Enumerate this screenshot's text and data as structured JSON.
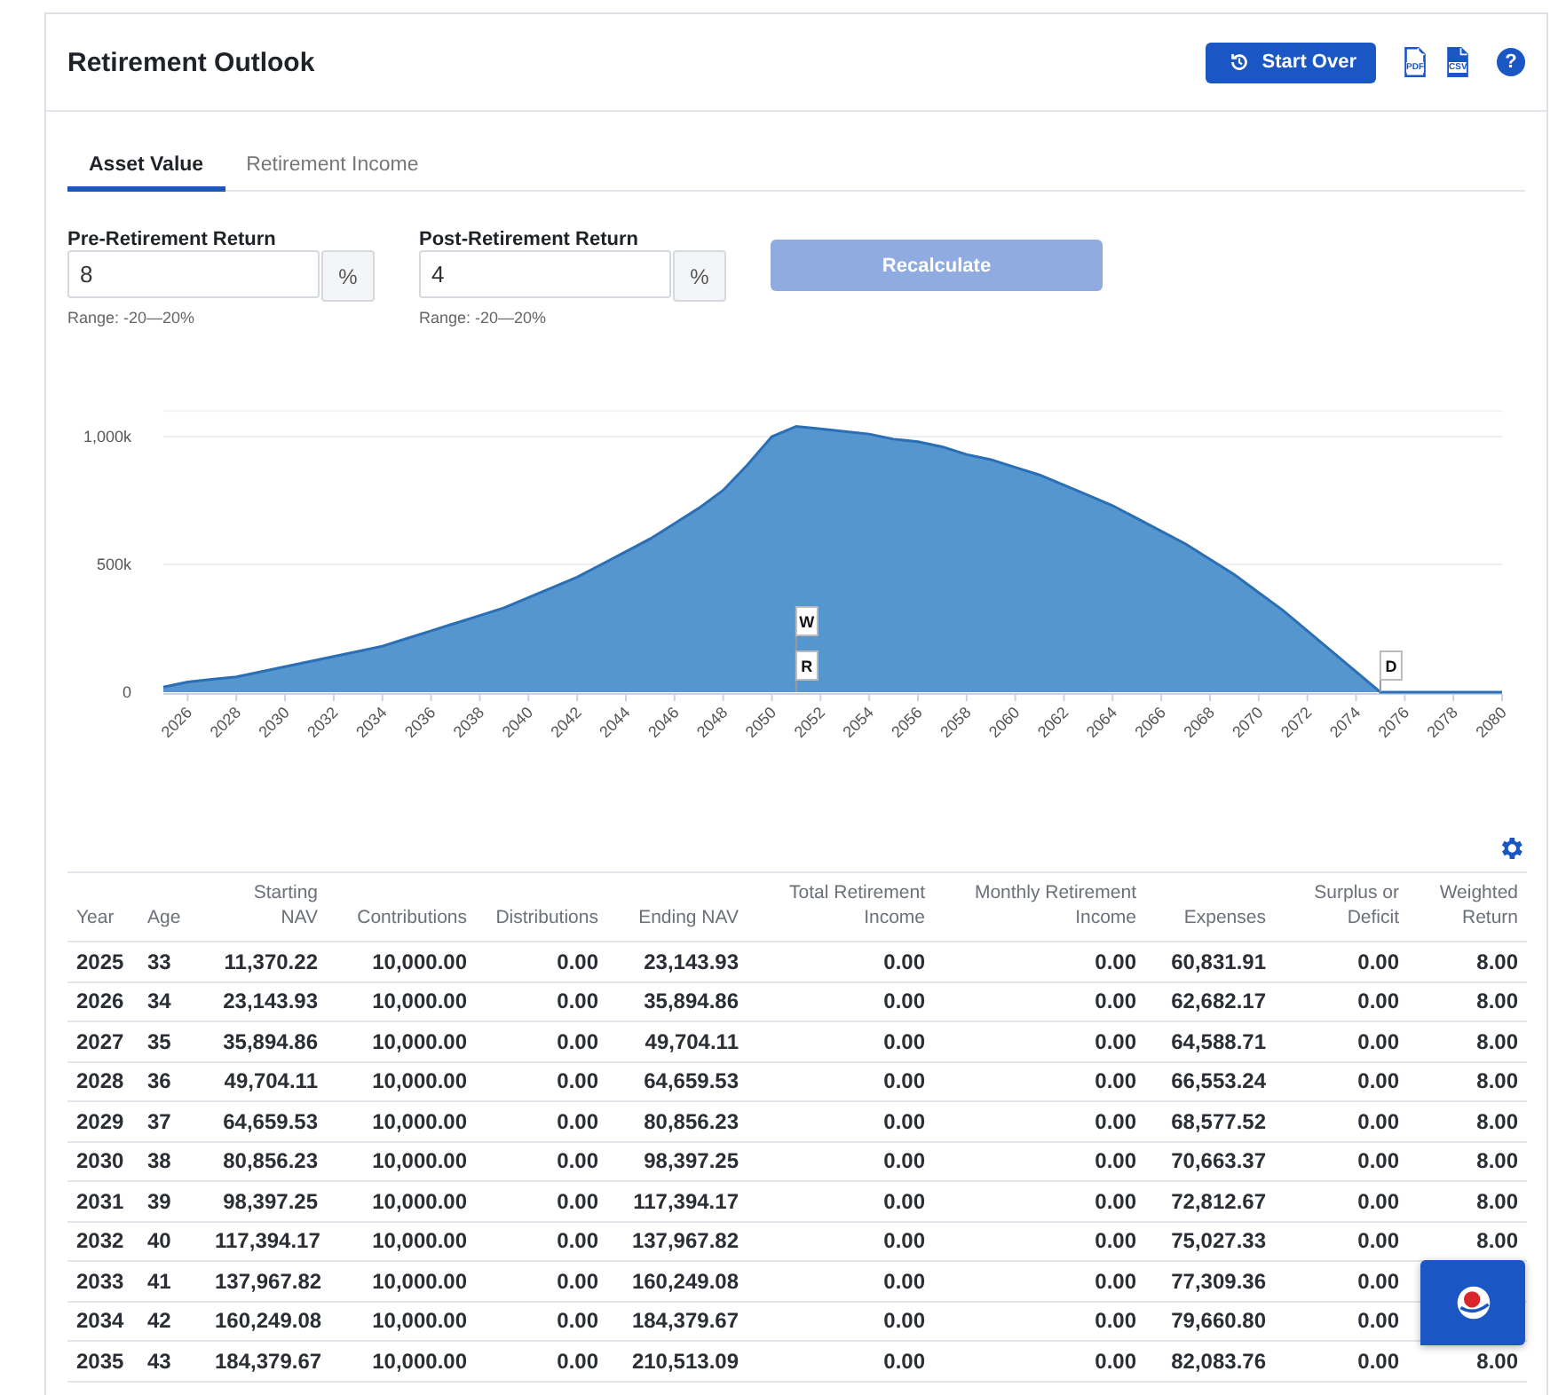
{
  "header": {
    "title": "Retirement Outlook",
    "start_over": "Start Over",
    "export_icons": [
      {
        "kind": "pdf",
        "label": "PDF"
      },
      {
        "kind": "csv",
        "label": "CSV"
      }
    ],
    "help": "?"
  },
  "tabs": [
    {
      "label": "Asset Value",
      "selected": true
    },
    {
      "label": "Retirement Income",
      "selected": false
    }
  ],
  "inputs": [
    {
      "label": "Pre-Retirement Return",
      "value": "8",
      "unit": "%",
      "hint": "Range: -20—20%"
    },
    {
      "label": "Post-Retirement Return",
      "value": "4",
      "unit": "%",
      "hint": "Range: -20—20%"
    }
  ],
  "recalculate": {
    "label": "Recalculate",
    "disabled": true
  },
  "chart": {
    "chart_data": {
      "type": "area",
      "x": [
        2025,
        2026,
        2027,
        2028,
        2029,
        2030,
        2031,
        2032,
        2033,
        2034,
        2035,
        2036,
        2037,
        2038,
        2039,
        2040,
        2041,
        2042,
        2043,
        2044,
        2045,
        2046,
        2047,
        2048,
        2049,
        2050,
        2051,
        2052,
        2053,
        2054,
        2055,
        2056,
        2057,
        2058,
        2059,
        2060,
        2061,
        2062,
        2063,
        2064,
        2065,
        2066,
        2067,
        2068,
        2069,
        2070,
        2071,
        2072,
        2073,
        2074,
        2075,
        2076,
        2077,
        2078,
        2079,
        2080
      ],
      "series": [
        {
          "color": "#5596cf",
          "values": [
            20000,
            40000,
            50000,
            60000,
            80000,
            100000,
            120000,
            140000,
            160000,
            180000,
            210000,
            240000,
            270000,
            300000,
            330000,
            370000,
            410000,
            450000,
            500000,
            550000,
            600000,
            660000,
            720000,
            790000,
            890000,
            1000000,
            1040000,
            1030000,
            1020000,
            1010000,
            990000,
            980000,
            960000,
            930000,
            910000,
            880000,
            850000,
            810000,
            770000,
            730000,
            680000,
            630000,
            580000,
            520000,
            460000,
            390000,
            320000,
            240000,
            160000,
            80000,
            0,
            0,
            0,
            0,
            0,
            0
          ]
        }
      ],
      "xlim": [
        2025,
        2080
      ],
      "xticks": [
        2026,
        2028,
        2030,
        2032,
        2034,
        2036,
        2038,
        2040,
        2042,
        2044,
        2046,
        2048,
        2050,
        2052,
        2054,
        2056,
        2058,
        2060,
        2062,
        2064,
        2066,
        2068,
        2070,
        2072,
        2074,
        2076,
        2078,
        2080
      ],
      "yticks": [
        {
          "value": 0,
          "label": "0"
        },
        {
          "value": 500000,
          "label": "500k"
        },
        {
          "value": 1000000,
          "label": "1,000k"
        }
      ],
      "ylim": [
        0,
        1100000
      ],
      "annotations": [
        "W",
        "R",
        "D"
      ]
    }
  },
  "table": {
    "columns": [
      "Year",
      "Age",
      "Starting NAV",
      "Contributions",
      "Distributions",
      "Ending NAV",
      "Total Retirement Income",
      "Monthly Retirement Income",
      "Expenses",
      "Surplus or Deficit",
      "Weighted Return"
    ],
    "rows": [
      [
        "2025",
        "33",
        "11,370.22",
        "10,000.00",
        "0.00",
        "23,143.93",
        "0.00",
        "0.00",
        "60,831.91",
        "0.00",
        "8.00"
      ],
      [
        "2026",
        "34",
        "23,143.93",
        "10,000.00",
        "0.00",
        "35,894.86",
        "0.00",
        "0.00",
        "62,682.17",
        "0.00",
        "8.00"
      ],
      [
        "2027",
        "35",
        "35,894.86",
        "10,000.00",
        "0.00",
        "49,704.11",
        "0.00",
        "0.00",
        "64,588.71",
        "0.00",
        "8.00"
      ],
      [
        "2028",
        "36",
        "49,704.11",
        "10,000.00",
        "0.00",
        "64,659.53",
        "0.00",
        "0.00",
        "66,553.24",
        "0.00",
        "8.00"
      ],
      [
        "2029",
        "37",
        "64,659.53",
        "10,000.00",
        "0.00",
        "80,856.23",
        "0.00",
        "0.00",
        "68,577.52",
        "0.00",
        "8.00"
      ],
      [
        "2030",
        "38",
        "80,856.23",
        "10,000.00",
        "0.00",
        "98,397.25",
        "0.00",
        "0.00",
        "70,663.37",
        "0.00",
        "8.00"
      ],
      [
        "2031",
        "39",
        "98,397.25",
        "10,000.00",
        "0.00",
        "117,394.17",
        "0.00",
        "0.00",
        "72,812.67",
        "0.00",
        "8.00"
      ],
      [
        "2032",
        "40",
        "117,394.17",
        "10,000.00",
        "0.00",
        "137,967.82",
        "0.00",
        "0.00",
        "75,027.33",
        "0.00",
        "8.00"
      ],
      [
        "2033",
        "41",
        "137,967.82",
        "10,000.00",
        "0.00",
        "160,249.08",
        "0.00",
        "0.00",
        "77,309.36",
        "0.00"
      ],
      [
        "2034",
        "42",
        "160,249.08",
        "10,000.00",
        "0.00",
        "184,379.67",
        "0.00",
        "0.00",
        "79,660.80",
        "0.00"
      ],
      [
        "2035",
        "43",
        "184,379.67",
        "10,000.00",
        "0.00",
        "210,513.09",
        "0.00",
        "0.00",
        "82,083.76",
        "0.00",
        "8.00"
      ]
    ]
  }
}
